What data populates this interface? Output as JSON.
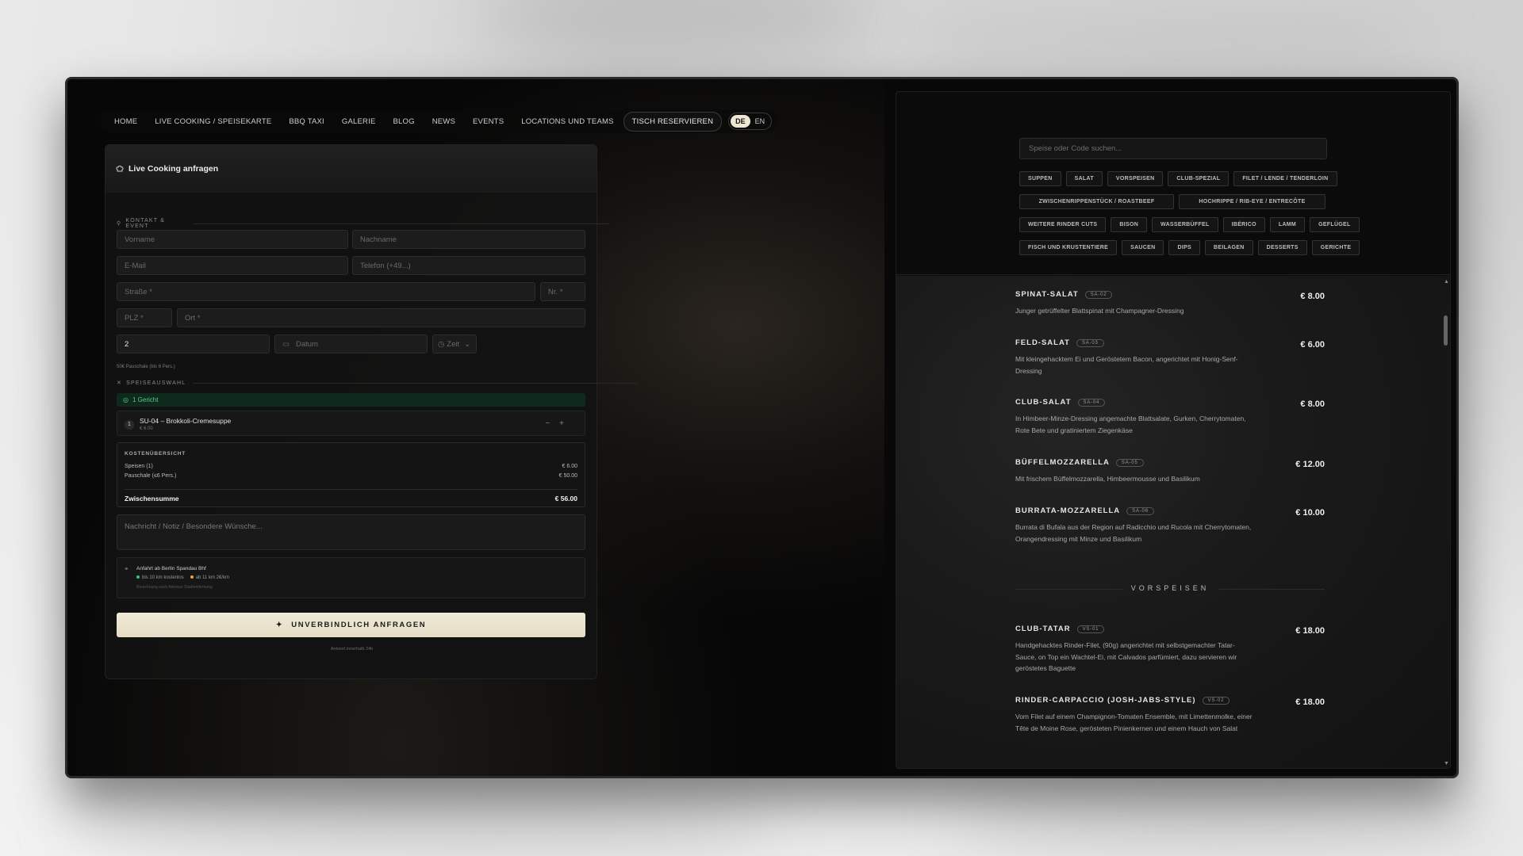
{
  "nav": {
    "items": [
      "HOME",
      "LIVE COOKING / SPEISEKARTE",
      "BBQ TAXI",
      "GALERIE",
      "BLOG",
      "NEWS",
      "EVENTS",
      "LOCATIONS UND TEAMS"
    ],
    "cta": "TISCH RESERVIEREN",
    "lang": [
      "DE",
      "EN"
    ]
  },
  "form": {
    "title": "Live Cooking anfragen",
    "section_contact": "KONTAKT & EVENT",
    "fields": {
      "vorname": "Vorname",
      "nachname": "Nachname",
      "email": "E-Mail",
      "telefon": "Telefon (+49...)",
      "strasse": "Straße *",
      "nr": "Nr. *",
      "plz": "PLZ *",
      "ort": "Ort *",
      "persons": "2",
      "datum": "Datum",
      "zeit": "Zeit"
    },
    "persons_hint": "50€ Pauschale (bis 6 Pers.)",
    "section_menu": "SPEISEAUSWAHL",
    "selected_count": "1 Gericht",
    "dish": {
      "num": "1",
      "name": "SU-04 – Brokkoli-Cremesuppe",
      "price": "€ 6.00",
      "minus": "−",
      "plus": "+"
    },
    "cost": {
      "heading": "KOSTENÜBERSICHT",
      "rows": [
        {
          "label": "Speisen (1)",
          "value": "€ 6.00"
        },
        {
          "label": "Pauschale (≤6 Pers.)",
          "value": "€ 50.00"
        }
      ],
      "total_label": "Zwischensumme",
      "total_value": "€ 56.00"
    },
    "message_placeholder": "Nachricht / Notiz / Besondere Wünsche...",
    "travel": {
      "title": "Anfahrt ab Berlin Spandau Bhf",
      "free": "bis 10 km kostenlos",
      "paid": "ab 11 km 2€/km",
      "note": "Berechnung nach Adresse Stadtentfernung"
    },
    "submit": "UNVERBINDLICH ANFRAGEN",
    "submit_hint": "Antwort innerhalb 24h"
  },
  "menu": {
    "search_placeholder": "Speise oder Code suchen...",
    "categories": [
      [
        "SUPPEN",
        "SALAT",
        "VORSPEISEN",
        "CLUB-SPEZIAL",
        "FILET / LENDE / TENDERLOIN"
      ],
      [
        "ZWISCHENRIPPENSTÜCK / ROASTBEEF",
        "HOCHRIPPE / RIB-EYE / ENTRECÔTE"
      ],
      [
        "WEITERE RINDER CUTS",
        "BISON",
        "WASSERBÜFFEL",
        "IBÉRICO",
        "LAMM",
        "GEFLÜGEL"
      ],
      [
        "FISCH UND KRUSTENTIERE",
        "SAUCEN",
        "DIPS",
        "BEILAGEN",
        "DESSERTS",
        "GERICHTE"
      ]
    ],
    "items": [
      {
        "name": "SPINAT-SALAT",
        "code": "SA-02",
        "price": "€ 8.00",
        "desc": "Junger getrüffelter Blattspinat mit Champagner-Dressing"
      },
      {
        "name": "FELD-SALAT",
        "code": "SA-03",
        "price": "€ 6.00",
        "desc": "Mit kleingehacktem Ei und Geröstetem Bacon, angerichtet mit Honig-Senf-Dressing"
      },
      {
        "name": "CLUB-SALAT",
        "code": "SA-04",
        "price": "€ 8.00",
        "desc": "In Himbeer-Minze-Dressing angemachte Blattsalate, Gurken, Cherrytomaten, Rote Bete und gratiniertem Ziegenkäse"
      },
      {
        "name": "BÜFFELMOZZARELLA",
        "code": "SA-05",
        "price": "€ 12.00",
        "desc": "Mit frischem Büffelmozzarella, Himbeermousse und Basilikum"
      },
      {
        "name": "BURRATA-MOZZARELLA",
        "code": "SA-06",
        "price": "€ 10.00",
        "desc": "Burrata di Bufala aus der Region auf Radicchio und Rucola mit Cherrytomaten, Orangendressing mit Minze und Basilikum"
      },
      {
        "name": "CLUB-TATAR",
        "code": "VS-01",
        "price": "€ 18.00",
        "desc": "Handgehacktes Rinder-Filet, (90g) angerichtet mit selbstgemachter Tatar-Sauce, on Top ein Wachtel-Ei, mit Calvados parfümiert, dazu servieren wir geröstetes Baguette"
      },
      {
        "name": "RINDER-CARPACCIO (JOSH-JABS-STYLE)",
        "code": "VS-02",
        "price": "€ 18.00",
        "desc": "Vom Filet auf einem Champignon-Tomaten Ensemble, mit Limettenmolke, einer Tête de Moine Rose, gerösteten Pinienkernen und einem Hauch von Salat"
      }
    ],
    "section_vorspeisen": "VORSPEISEN"
  }
}
